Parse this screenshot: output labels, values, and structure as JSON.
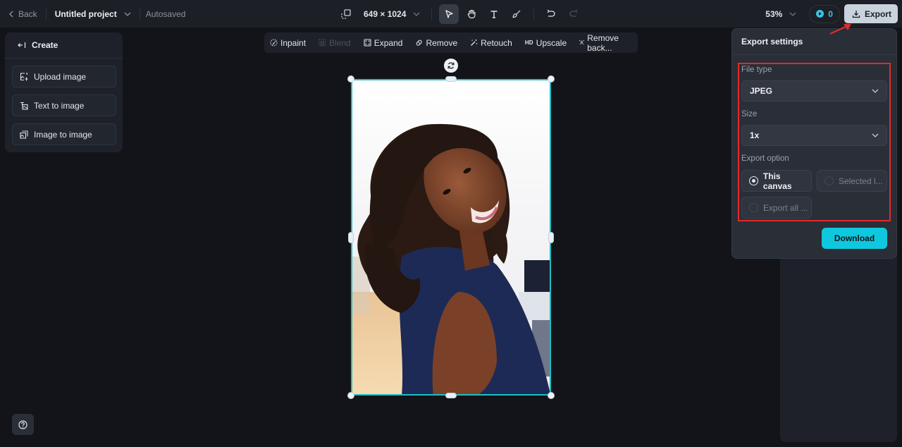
{
  "topbar": {
    "back_label": "Back",
    "project_name": "Untitled project",
    "save_status": "Autosaved",
    "canvas_size": "649 × 1024",
    "tools": [
      "select",
      "hand",
      "text",
      "brush",
      "undo",
      "redo"
    ],
    "active_tool": "select",
    "zoom": "53%",
    "credits": "0",
    "export_label": "Export"
  },
  "create_panel": {
    "title": "Create",
    "items": [
      {
        "label": "Upload image",
        "icon": "upload-image-icon"
      },
      {
        "label": "Text to image",
        "icon": "text-to-image-icon"
      },
      {
        "label": "Image to image",
        "icon": "image-to-image-icon"
      }
    ]
  },
  "edit_toolbar": {
    "items": [
      {
        "label": "Inpaint",
        "icon": "inpaint-icon",
        "enabled": true
      },
      {
        "label": "Blend",
        "icon": "blend-icon",
        "enabled": false
      },
      {
        "label": "Expand",
        "icon": "expand-icon",
        "enabled": true
      },
      {
        "label": "Remove",
        "icon": "eraser-icon",
        "enabled": true
      },
      {
        "label": "Retouch",
        "icon": "magic-wand-icon",
        "enabled": true
      },
      {
        "label": "Upscale",
        "icon": "hd-icon",
        "badge": "HD",
        "enabled": true
      },
      {
        "label": "Remove back...",
        "icon": "remove-background-icon",
        "enabled": true
      }
    ]
  },
  "canvas": {
    "image_description": "Smiling woman with curly hair in navy sleeveless top, blurred office background"
  },
  "export_settings": {
    "title": "Export settings",
    "file_type_label": "File type",
    "file_type_value": "JPEG",
    "size_label": "Size",
    "size_value": "1x",
    "export_option_label": "Export option",
    "options": [
      {
        "label": "This canvas",
        "checked": true
      },
      {
        "label": "Selected l...",
        "checked": false
      },
      {
        "label": "Export all ...",
        "checked": false
      }
    ],
    "download_label": "Download"
  },
  "colors": {
    "accent": "#0fc8de",
    "selection": "#1fbfc4",
    "annotation": "#e02b2b",
    "background": "#121419",
    "panel": "#1e2129"
  }
}
